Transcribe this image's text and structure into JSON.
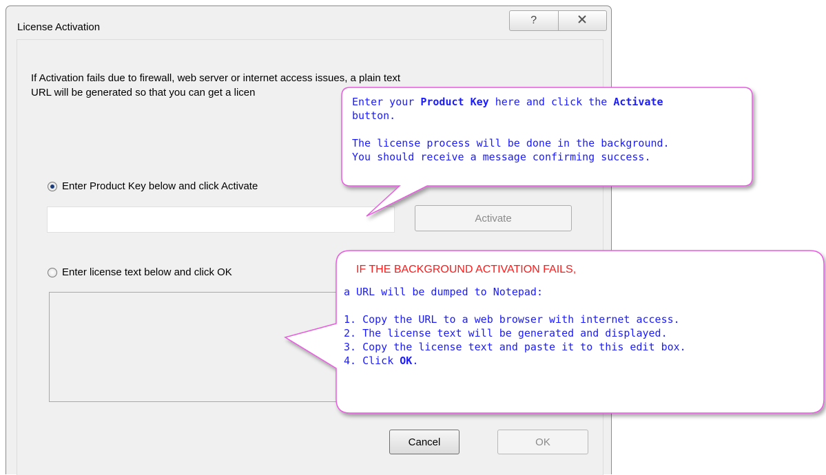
{
  "window": {
    "title": "License Activation",
    "help_glyph": "?",
    "close_glyph": "X"
  },
  "info_text_line1": "If Activation fails due to firewall, web server or internet access issues, a plain text",
  "info_text_line2": "URL will be generated so that you can get a licen",
  "option_key": {
    "label": "Enter Product Key below and click Activate",
    "selected": true,
    "input_value": "",
    "activate_label": "Activate"
  },
  "option_text": {
    "label": "Enter license text below and click OK",
    "selected": false
  },
  "buttons": {
    "cancel": "Cancel",
    "ok": "OK"
  },
  "callout1": {
    "l1_a": "Enter your ",
    "l1_b": "Product Key",
    "l1_c": " here and click the ",
    "l1_d": "Activate",
    "l2": "button.",
    "l3": "The license process will be done in the background.",
    "l4": "You should receive a message confirming success."
  },
  "callout2": {
    "heading": "IF THE BACKGROUND ACTIVATION FAILS,",
    "intro": "a URL will be dumped to Notepad:",
    "step1": "1. Copy the URL to a web browser with internet access.",
    "step2": "2. The license text will be generated and displayed.",
    "step3": "3. Copy the license text and paste it to this edit box.",
    "step4_a": "4. Click ",
    "step4_b": "OK",
    "step4_c": "."
  },
  "colors": {
    "callout_border": "#e85be0",
    "callout_text": "#1a1aff",
    "callout_heading": "#ff1a1a"
  }
}
